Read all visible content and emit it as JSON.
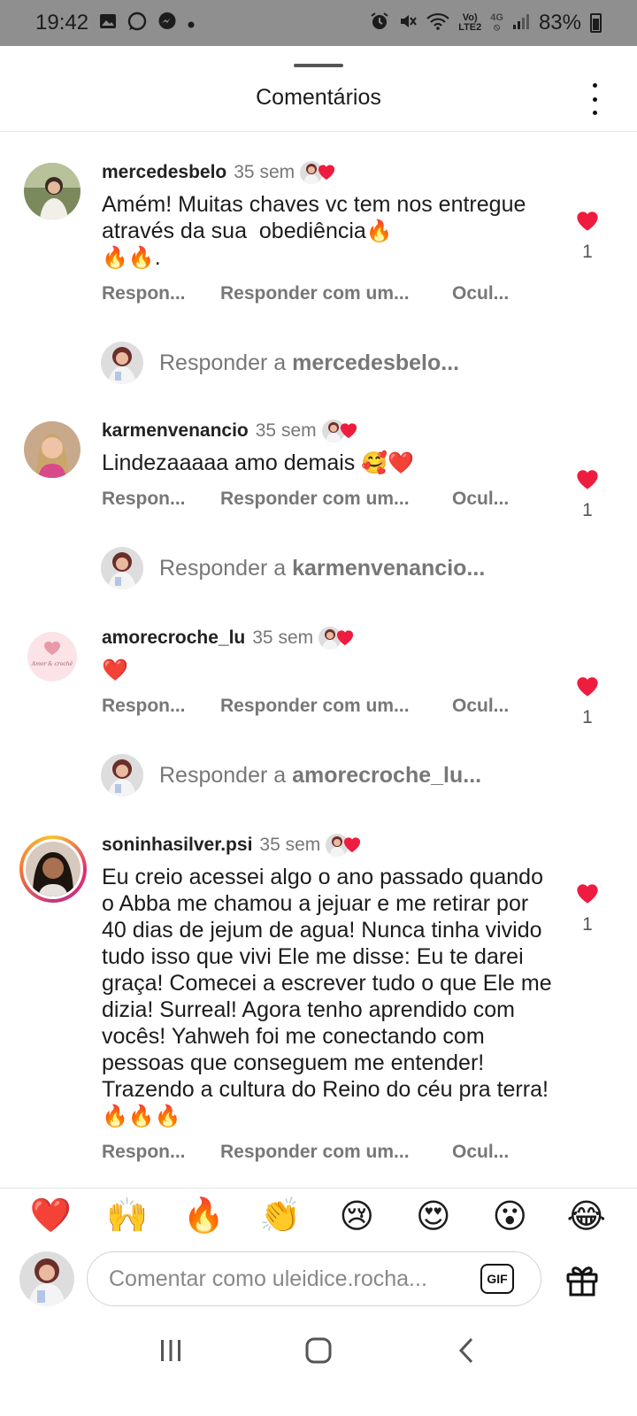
{
  "status_bar": {
    "time": "19:42",
    "net_top": "Vo)",
    "net_bottom": "LTE2",
    "net2_top": "4G",
    "battery": "83%"
  },
  "sheet": {
    "title": "Comentários"
  },
  "comments": [
    {
      "username": "mercedesbelo",
      "time": "35 sem",
      "text": "Amém! Muitas chaves vc tem nos entregue através da sua  obediência",
      "text_end": ".",
      "likes": "1",
      "reply": "Respon...",
      "reply_with": "Responder com um...",
      "hide": "Ocul...",
      "reply_prompt_prefix": "Responder a",
      "reply_prompt_user": "mercedesbelo..."
    },
    {
      "username": "karmenvenancio",
      "time": "35 sem",
      "text": "Lindezaaaaa amo demais ",
      "likes": "1",
      "reply": "Respon...",
      "reply_with": "Responder com um...",
      "hide": "Ocul...",
      "reply_prompt_prefix": "Responder a",
      "reply_prompt_user": "karmenvenancio..."
    },
    {
      "username": "amorecroche_lu",
      "time": "35 sem",
      "avatar_text": "Amor & crochê",
      "likes": "1",
      "reply": "Respon...",
      "reply_with": "Responder com um...",
      "hide": "Ocul...",
      "reply_prompt_prefix": "Responder a",
      "reply_prompt_user": "amorecroche_lu..."
    },
    {
      "username": "soninhasilver.psi",
      "time": "35 sem",
      "text": "Eu creio acessei algo o ano passado quando o Abba me chamou a jejuar e me retirar por 40 dias de jejum de agua! Nunca tinha vivido tudo isso que vivi Ele me disse: Eu te darei graça! Comecei a escrever tudo o que Ele me dizia! Surreal! Agora tenho aprendido com vocês! Yahweh foi me conectando com pessoas que conseguem me entender! Trazendo a cultura do Reino do céu pra terra!",
      "likes": "1",
      "reply": "Respon...",
      "reply_with": "Responder com um...",
      "hide": "Ocul..."
    }
  ],
  "emoji_bar": [
    "❤️",
    "🙌",
    "🔥",
    "👏",
    "😢",
    "😍",
    "😮",
    "😂"
  ],
  "composer": {
    "placeholder": "Comentar como uleidice.rocha...",
    "gif_label": "GIF"
  },
  "colors": {
    "heart": "#ee1d3f",
    "status_bar_bg": "#8f8f8f",
    "muted_text": "#777777"
  }
}
